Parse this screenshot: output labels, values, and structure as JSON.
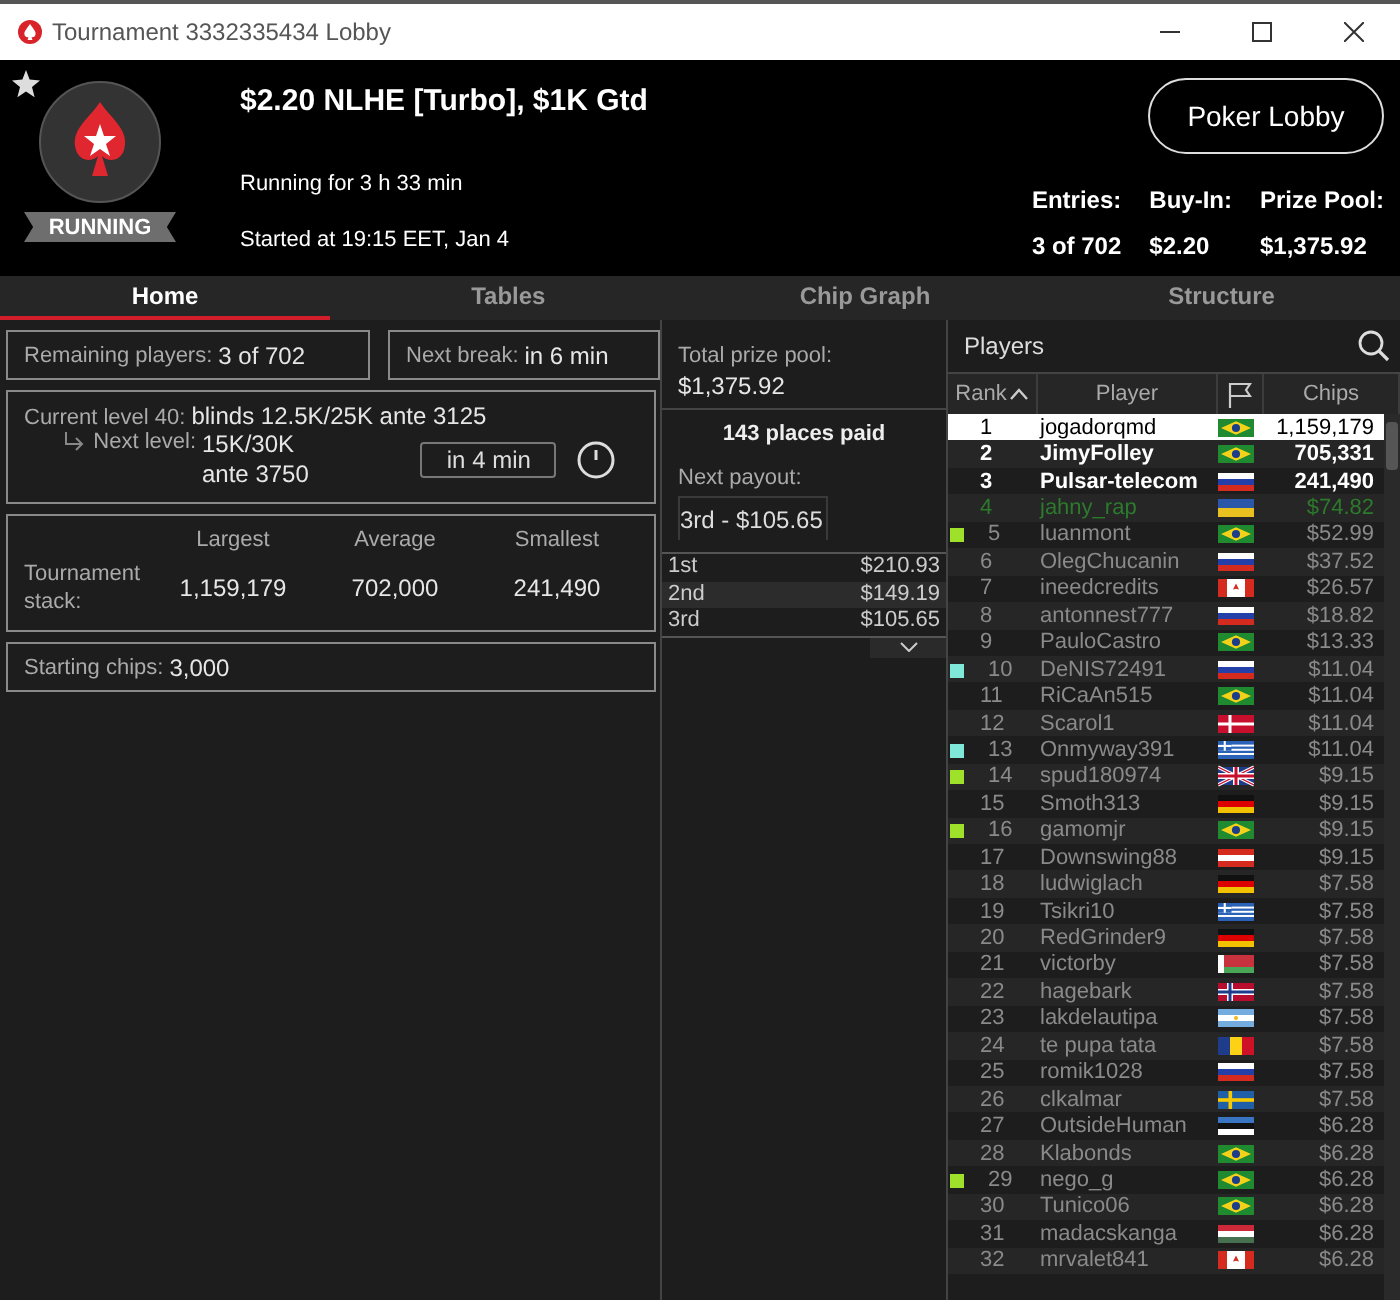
{
  "window": {
    "title": "Tournament 3332335434 Lobby"
  },
  "header": {
    "status": "RUNNING",
    "name": "$2.20 NLHE [Turbo], $1K Gtd",
    "running": "Running for 3 h 33 min",
    "started": "Started at 19:15 EET, Jan 4",
    "button": "Poker Lobby",
    "stats": [
      {
        "label": "Entries:",
        "value": "3 of 702"
      },
      {
        "label": "Buy-In:",
        "value": "$2.20"
      },
      {
        "label": "Prize Pool:",
        "value": "$1,375.92"
      }
    ]
  },
  "tabs": [
    {
      "label": "Home",
      "selected": true
    },
    {
      "label": "Tables",
      "selected": false
    },
    {
      "label": "Chip Graph",
      "selected": false
    },
    {
      "label": "Structure",
      "selected": false
    }
  ],
  "info": {
    "remaining": {
      "label": "Remaining players:",
      "value": "3 of 702"
    },
    "next_break": {
      "label": "Next break:",
      "value": "in 6 min"
    },
    "current_level": {
      "label": "Current level 40:",
      "value": "blinds 12.5K/25K ante 3125"
    },
    "next_level": {
      "label": "Next level:",
      "lines": [
        "15K/30K",
        "ante 3750"
      ]
    },
    "timer": "in 4 min",
    "stack": {
      "label": "Tournament stack:",
      "columns": [
        "Largest",
        "Average",
        "Smallest"
      ],
      "values": [
        "1,159,179",
        "702,000",
        "241,490"
      ]
    },
    "starting": {
      "label": "Starting chips:",
      "value": "3,000"
    }
  },
  "prizes": {
    "total_label": "Total prize pool:",
    "total": "$1,375.92",
    "places": "143 places paid",
    "next_label": "Next payout:",
    "next": "3rd - $105.65",
    "payouts": [
      {
        "place": "1st",
        "amount": "$210.93"
      },
      {
        "place": "2nd",
        "amount": "$149.19"
      },
      {
        "place": "3rd",
        "amount": "$105.65"
      }
    ]
  },
  "players": {
    "title": "Players",
    "columns": [
      "Rank",
      "Player",
      "Chips"
    ],
    "rows": [
      {
        "rank": "1",
        "name": "jogadorqmd",
        "flag": {
          "kind": "br"
        },
        "chips": "1,159,179",
        "kind": "active",
        "selected": true
      },
      {
        "rank": "2",
        "name": "JimyFolley",
        "flag": {
          "kind": "br"
        },
        "chips": "705,331",
        "kind": "active",
        "selected": false
      },
      {
        "rank": "3",
        "name": "Pulsar-telecom",
        "flag": {
          "kind": "ru"
        },
        "chips": "241,490",
        "kind": "active",
        "selected": false
      },
      {
        "rank": "4",
        "name": "jahny_rap",
        "flag": {
          "kind": "ua"
        },
        "chips": "$74.82",
        "kind": "current",
        "selected": false
      },
      {
        "rank": "5",
        "name": "luanmont",
        "flag": {
          "kind": "br"
        },
        "chips": "$52.99",
        "kind": "out",
        "selected": false,
        "color": "#9ee02a"
      },
      {
        "rank": "6",
        "name": "OlegChucanin",
        "flag": {
          "kind": "ru"
        },
        "chips": "$37.52",
        "kind": "out",
        "selected": false
      },
      {
        "rank": "7",
        "name": "ineedcredits",
        "flag": {
          "kind": "ca"
        },
        "chips": "$26.57",
        "kind": "out",
        "selected": false
      },
      {
        "rank": "8",
        "name": "antonnest777",
        "flag": {
          "kind": "ru"
        },
        "chips": "$18.82",
        "kind": "out",
        "selected": false
      },
      {
        "rank": "9",
        "name": "PauloCastro",
        "flag": {
          "kind": "br"
        },
        "chips": "$13.33",
        "kind": "out",
        "selected": false
      },
      {
        "rank": "10",
        "name": "DeNIS72491",
        "flag": {
          "kind": "ru"
        },
        "chips": "$11.04",
        "kind": "out",
        "selected": false,
        "color": "#7fe8d8"
      },
      {
        "rank": "11",
        "name": "RiCaAn515",
        "flag": {
          "kind": "br"
        },
        "chips": "$11.04",
        "kind": "out",
        "selected": false
      },
      {
        "rank": "12",
        "name": "Scarol1",
        "flag": {
          "kind": "dk"
        },
        "chips": "$11.04",
        "kind": "out",
        "selected": false
      },
      {
        "rank": "13",
        "name": "Onmyway391",
        "flag": {
          "kind": "gr"
        },
        "chips": "$11.04",
        "kind": "out",
        "selected": false,
        "color": "#7fe8d8"
      },
      {
        "rank": "14",
        "name": "spud180974",
        "flag": {
          "kind": "gb"
        },
        "chips": "$9.15",
        "kind": "out",
        "selected": false,
        "color": "#9ee02a"
      },
      {
        "rank": "15",
        "name": "Smoth313",
        "flag": {
          "kind": "de"
        },
        "chips": "$9.15",
        "kind": "out",
        "selected": false
      },
      {
        "rank": "16",
        "name": "gamomjr",
        "flag": {
          "kind": "br"
        },
        "chips": "$9.15",
        "kind": "out",
        "selected": false,
        "color": "#9ee02a"
      },
      {
        "rank": "17",
        "name": "Downswing88",
        "flag": {
          "kind": "at"
        },
        "chips": "$9.15",
        "kind": "out",
        "selected": false
      },
      {
        "rank": "18",
        "name": "ludwiglach",
        "flag": {
          "kind": "de"
        },
        "chips": "$7.58",
        "kind": "out",
        "selected": false
      },
      {
        "rank": "19",
        "name": "Tsikri10",
        "flag": {
          "kind": "gr"
        },
        "chips": "$7.58",
        "kind": "out",
        "selected": false
      },
      {
        "rank": "20",
        "name": "RedGrinder9",
        "flag": {
          "kind": "de"
        },
        "chips": "$7.58",
        "kind": "out",
        "selected": false
      },
      {
        "rank": "21",
        "name": "victorby",
        "flag": {
          "kind": "by"
        },
        "chips": "$7.58",
        "kind": "out",
        "selected": false
      },
      {
        "rank": "22",
        "name": "hagebark",
        "flag": {
          "kind": "no"
        },
        "chips": "$7.58",
        "kind": "out",
        "selected": false
      },
      {
        "rank": "23",
        "name": "lakdelautipa",
        "flag": {
          "kind": "ar"
        },
        "chips": "$7.58",
        "kind": "out",
        "selected": false
      },
      {
        "rank": "24",
        "name": "te pupa tata",
        "flag": {
          "kind": "ro"
        },
        "chips": "$7.58",
        "kind": "out",
        "selected": false
      },
      {
        "rank": "25",
        "name": "romik1028",
        "flag": {
          "kind": "ru"
        },
        "chips": "$7.58",
        "kind": "out",
        "selected": false
      },
      {
        "rank": "26",
        "name": "clkalmar",
        "flag": {
          "kind": "se"
        },
        "chips": "$7.58",
        "kind": "out",
        "selected": false
      },
      {
        "rank": "27",
        "name": "OutsideHuman",
        "flag": {
          "kind": "ee"
        },
        "chips": "$6.28",
        "kind": "out",
        "selected": false
      },
      {
        "rank": "28",
        "name": "Klabonds",
        "flag": {
          "kind": "br"
        },
        "chips": "$6.28",
        "kind": "out",
        "selected": false
      },
      {
        "rank": "29",
        "name": "nego_g",
        "flag": {
          "kind": "br"
        },
        "chips": "$6.28",
        "kind": "out",
        "selected": false,
        "color": "#9ee02a"
      },
      {
        "rank": "30",
        "name": "Tunico06",
        "flag": {
          "kind": "br"
        },
        "chips": "$6.28",
        "kind": "out",
        "selected": false
      },
      {
        "rank": "31",
        "name": "madacskanga",
        "flag": {
          "kind": "hu"
        },
        "chips": "$6.28",
        "kind": "out",
        "selected": false
      },
      {
        "rank": "32",
        "name": "mrvalet841",
        "flag": {
          "kind": "ca"
        },
        "chips": "$6.28",
        "kind": "out",
        "selected": false
      }
    ]
  }
}
